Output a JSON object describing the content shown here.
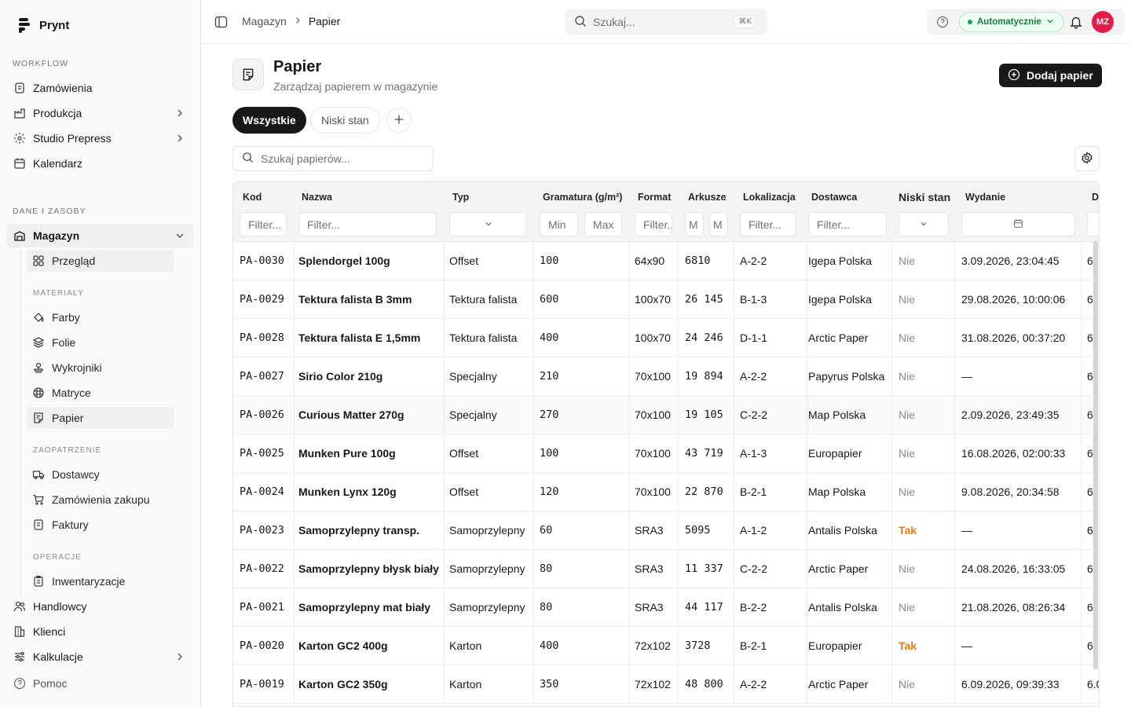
{
  "app": {
    "name": "Prynt"
  },
  "sidebar": {
    "workflow_label": "WORKFLOW",
    "workflow": [
      {
        "label": "Zamówienia",
        "icon": "orders-icon"
      },
      {
        "label": "Produkcja",
        "icon": "factory-icon"
      },
      {
        "label": "Studio Prepress",
        "icon": "sparkle-icon"
      },
      {
        "label": "Kalendarz",
        "icon": "calendar-icon"
      }
    ],
    "data_label": "DANE I ZASOBY",
    "magazyn": "Magazyn",
    "przeglad": "Przegląd",
    "materialy_label": "MATERIAŁY",
    "materialy": [
      "Farby",
      "Folie",
      "Wykrojniki",
      "Matryce",
      "Papier"
    ],
    "zaopatrzenie_label": "ZAOPATRZENIE",
    "zaopatrzenie": [
      "Dostawcy",
      "Zamówienia zakupu",
      "Faktury"
    ],
    "operacje_label": "OPERACJE",
    "operacje": [
      "Inwentaryzacje"
    ],
    "more": [
      "Handlowcy",
      "Klienci",
      "Kalkulacje"
    ],
    "help": "Pomoc"
  },
  "topbar": {
    "breadcrumb": [
      "Magazyn",
      "Papier"
    ],
    "search_placeholder": "Szukaj...",
    "shortcut": "⌘K",
    "mode": "Automatycznie",
    "avatar": "MZ"
  },
  "page": {
    "title": "Papier",
    "subtitle": "Zarządzaj papierem w magazynie",
    "add_button": "Dodaj papier",
    "tabs": [
      "Wszystkie",
      "Niski stan"
    ],
    "search_placeholder": "Szukaj papierów..."
  },
  "table": {
    "columns": [
      "Kod",
      "Nazwa",
      "Typ",
      "Gramatura (g/m²)",
      "Format",
      "Arkusze",
      "Lokalizacja",
      "Dostawca",
      "Niski stan",
      "Wydanie"
    ],
    "filters": {
      "kod": "Filter...",
      "nazwa": "Filter...",
      "min": "Min",
      "max": "Max",
      "format": "Filter...",
      "arkusze_min": "M",
      "arkusze_max": "M",
      "lokalizacja": "Filter...",
      "dostawca": "Filter..."
    },
    "rows": [
      {
        "kod": "PA-0030",
        "nazwa": "Splendorgel 100g",
        "typ": "Offset",
        "gram": "100",
        "format": "64x90",
        "arkusze": "6810",
        "lok": "A-2-2",
        "dost": "Igepa Polska",
        "niski": "Nie",
        "wydanie": "3.09.2026, 23:04:45",
        "next": "6"
      },
      {
        "kod": "PA-0029",
        "nazwa": "Tektura falista B 3mm",
        "typ": "Tektura falista",
        "gram": "600",
        "format": "100x70",
        "arkusze": "26 145",
        "lok": "B-1-3",
        "dost": "Igepa Polska",
        "niski": "Nie",
        "wydanie": "29.08.2026, 10:00:06",
        "next": "6"
      },
      {
        "kod": "PA-0028",
        "nazwa": "Tektura falista E 1,5mm",
        "typ": "Tektura falista",
        "gram": "400",
        "format": "100x70",
        "arkusze": "24 246",
        "lok": "D-1-1",
        "dost": "Arctic Paper",
        "niski": "Nie",
        "wydanie": "31.08.2026, 00:37:20",
        "next": "6"
      },
      {
        "kod": "PA-0027",
        "nazwa": "Sirio Color 210g",
        "typ": "Specjalny",
        "gram": "210",
        "format": "70x100",
        "arkusze": "19 894",
        "lok": "A-2-2",
        "dost": "Papyrus Polska",
        "niski": "Nie",
        "wydanie": "—",
        "next": "6"
      },
      {
        "kod": "PA-0026",
        "nazwa": "Curious Matter 270g",
        "typ": "Specjalny",
        "gram": "270",
        "format": "70x100",
        "arkusze": "19 105",
        "lok": "C-2-2",
        "dost": "Map Polska",
        "niski": "Nie",
        "wydanie": "2.09.2026, 23:49:35",
        "next": "6"
      },
      {
        "kod": "PA-0025",
        "nazwa": "Munken Pure 100g",
        "typ": "Offset",
        "gram": "100",
        "format": "70x100",
        "arkusze": "43 719",
        "lok": "A-1-3",
        "dost": "Europapier",
        "niski": "Nie",
        "wydanie": "16.08.2026, 02:00:33",
        "next": "6"
      },
      {
        "kod": "PA-0024",
        "nazwa": "Munken Lynx 120g",
        "typ": "Offset",
        "gram": "120",
        "format": "70x100",
        "arkusze": "22 870",
        "lok": "B-2-1",
        "dost": "Map Polska",
        "niski": "Nie",
        "wydanie": "9.08.2026, 20:34:58",
        "next": "6"
      },
      {
        "kod": "PA-0023",
        "nazwa": "Samoprzylepny transp.",
        "typ": "Samoprzylepny",
        "gram": "60",
        "format": "SRA3",
        "arkusze": "5095",
        "lok": "A-1-2",
        "dost": "Antalis Polska",
        "niski": "Tak",
        "wydanie": "—",
        "next": "6"
      },
      {
        "kod": "PA-0022",
        "nazwa": "Samoprzylepny błysk biały",
        "typ": "Samoprzylepny",
        "gram": "80",
        "format": "SRA3",
        "arkusze": "11 337",
        "lok": "C-2-2",
        "dost": "Arctic Paper",
        "niski": "Nie",
        "wydanie": "24.08.2026, 16:33:05",
        "next": "6"
      },
      {
        "kod": "PA-0021",
        "nazwa": "Samoprzylepny mat biały",
        "typ": "Samoprzylepny",
        "gram": "80",
        "format": "SRA3",
        "arkusze": "44 117",
        "lok": "B-2-2",
        "dost": "Antalis Polska",
        "niski": "Nie",
        "wydanie": "21.08.2026, 08:26:34",
        "next": "6"
      },
      {
        "kod": "PA-0020",
        "nazwa": "Karton GC2 400g",
        "typ": "Karton",
        "gram": "400",
        "format": "72x102",
        "arkusze": "3728",
        "lok": "B-2-1",
        "dost": "Europapier",
        "niski": "Tak",
        "wydanie": "—",
        "next": "6"
      },
      {
        "kod": "PA-0019",
        "nazwa": "Karton GC2 350g",
        "typ": "Karton",
        "gram": "350",
        "format": "72x102",
        "arkusze": "48 800",
        "lok": "A-2-2",
        "dost": "Arctic Paper",
        "niski": "Nie",
        "wydanie": "6.09.2026, 09:39:33",
        "next": "6.0"
      }
    ]
  },
  "colors": {
    "accent": "#18181b",
    "low_stock": "#ea7a10",
    "status_green": "#16a34a",
    "avatar": "#e11d48"
  }
}
